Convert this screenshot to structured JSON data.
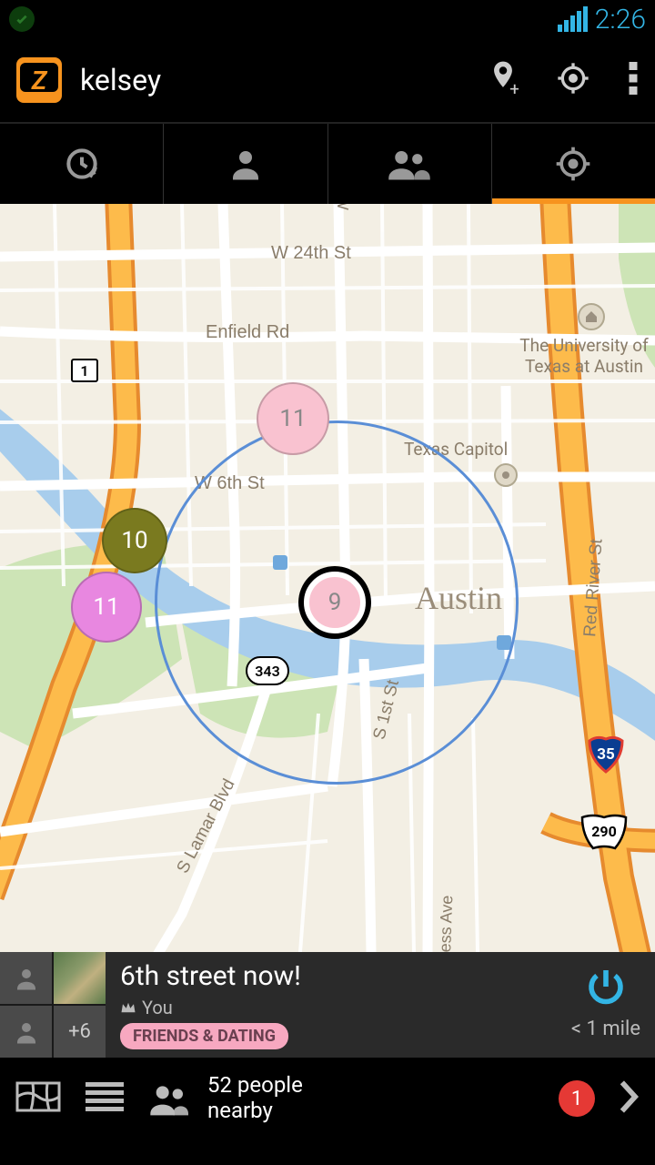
{
  "status_bar": {
    "time": "2:26"
  },
  "header": {
    "username": "kelsey"
  },
  "map": {
    "city": "Austin",
    "labels": {
      "w24th": "W 24th St",
      "enfield": "Enfield Rd",
      "w6th": "W 6th St",
      "slamar": "S Lamar Blvd",
      "s1st": "S 1st St",
      "redriver": "Red River St",
      "nlamar": "N Lamar Blvd",
      "congress": "Congress Ave",
      "ut": "The University of Texas at Austin",
      "capitol": "Texas Capitol"
    },
    "shields": {
      "hwy1": "1",
      "loop343": "343",
      "i35": "35",
      "us290": "290"
    },
    "clusters": {
      "top_pink": "11",
      "olive": "10",
      "bright_pink": "11",
      "center": "9"
    }
  },
  "event": {
    "title": "6th street now!",
    "author": "You",
    "tag": "FRIENDS & DATING",
    "distance": "< 1 mile",
    "more_count": "+6"
  },
  "bottom": {
    "nearby_line1": "52 people",
    "nearby_line2": "nearby",
    "badge": "1"
  }
}
